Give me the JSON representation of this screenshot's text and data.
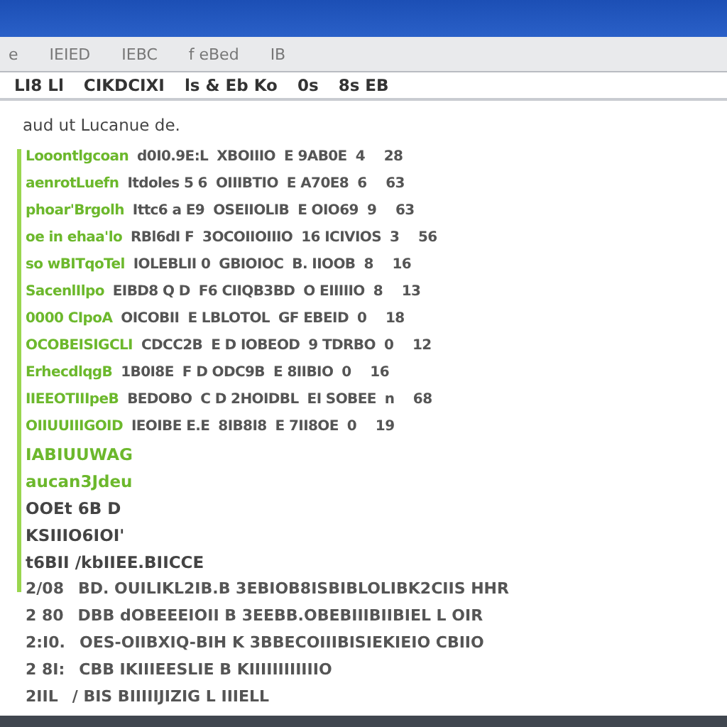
{
  "toolbar": {
    "items": [
      "e",
      "IEIED",
      "IEBC",
      "f eBed",
      "IB"
    ]
  },
  "header_line": {
    "items": [
      "LI8 Ll",
      "CIKDCIXI",
      "ls & Eb Ko",
      "0s",
      "8s EB"
    ]
  },
  "heading": "aud ut Lucanue de.",
  "rows": [
    {
      "name": "Looontlgcoan",
      "desc": "d0I0.9E:L",
      "code": "XBOIIIO",
      "tag": "E 9AB0E",
      "a": "4",
      "b": "28"
    },
    {
      "name": "aenrotLuefn",
      "desc": "Itdoles 5 6",
      "code": "OIIIBTIO",
      "tag": "E A70E8",
      "a": "6",
      "b": "63"
    },
    {
      "name": "phoar'Brgolh",
      "desc": "Ittc6 a E9",
      "code": "OSEIIOLIB",
      "tag": "E OIO69",
      "a": "9",
      "b": "63"
    },
    {
      "name": "oe in ehaa'lo",
      "desc": "RBl6dI F",
      "code": "3OCOIIOIIIO",
      "tag": "16 ICIVIOS",
      "a": "3",
      "b": "56"
    },
    {
      "name": "so wBITqoTel",
      "desc": "IOLEBLII 0",
      "code": "GBIOIOC",
      "tag": "B. IIOOB",
      "a": "8",
      "b": "16"
    },
    {
      "name": "SacenlIlpo",
      "desc": "EIBD8 Q D",
      "code": "F6 CIIQB3BD",
      "tag": "O EIIIIIO",
      "a": "8",
      "b": "13"
    },
    {
      "name": "0000 CIpoA",
      "desc": "OICOBII",
      "code": "E LBLOTOL",
      "tag": "GF EBEID",
      "a": "0",
      "b": "18"
    },
    {
      "name": "OCOBEISIGCLI",
      "desc": "CDCC2B",
      "code": "E D IOBEOD",
      "tag": "9 TDRBO",
      "a": "0",
      "b": "12"
    },
    {
      "name": "ErhecdlqgB",
      "desc": "1B0I8E",
      "code": "F D ODC9B",
      "tag": "E 8IIBIO",
      "a": "0",
      "b": "16"
    },
    {
      "name": "IIEEOTIIIpeB",
      "desc": "BEDOBO",
      "code": "C D 2HOIDBL",
      "tag": "EI SOBEE",
      "a": "n",
      "b": "68"
    },
    {
      "name": "OIIUUIIIGOID",
      "desc": "IEOIBE E.E",
      "code": "8IB8I8",
      "tag": "E 7II8OE",
      "a": "0",
      "b": "19"
    }
  ],
  "notes": [
    {
      "text": "IABIUUWAG",
      "highlighted": true
    },
    {
      "text": "aucan3Jdeu",
      "highlighted": true
    },
    {
      "text": "OOEt 6B D",
      "highlighted": false
    },
    {
      "text": "KSIIIO6IOI'",
      "highlighted": false
    },
    {
      "text": "t6BII /kbIIEE.BIICCE",
      "highlighted": false
    }
  ],
  "footer_rows": [
    {
      "num": "2/08",
      "text": "BD. OUILIKL2IB.B 3EBIOB8ISBIBLOLIBK2CIIS HHR"
    },
    {
      "num": "2 80",
      "text": "DBB dOBEEEIOII B 3EEBB.OBEBIIIBIIBIEL L OIR"
    },
    {
      "num": "2:I0.",
      "text": "OES-OIIBXIQ-BIH K 3BBECOIIIBISIEKIEIO CBIIO"
    },
    {
      "num": "2 8I:",
      "text": "CBB IKIIIEESLIE B KIIIIIIIIIIIIO"
    },
    {
      "num": "2IIL",
      "text": "/ BIS BIIIIIJIZIG L IIIELL"
    }
  ]
}
